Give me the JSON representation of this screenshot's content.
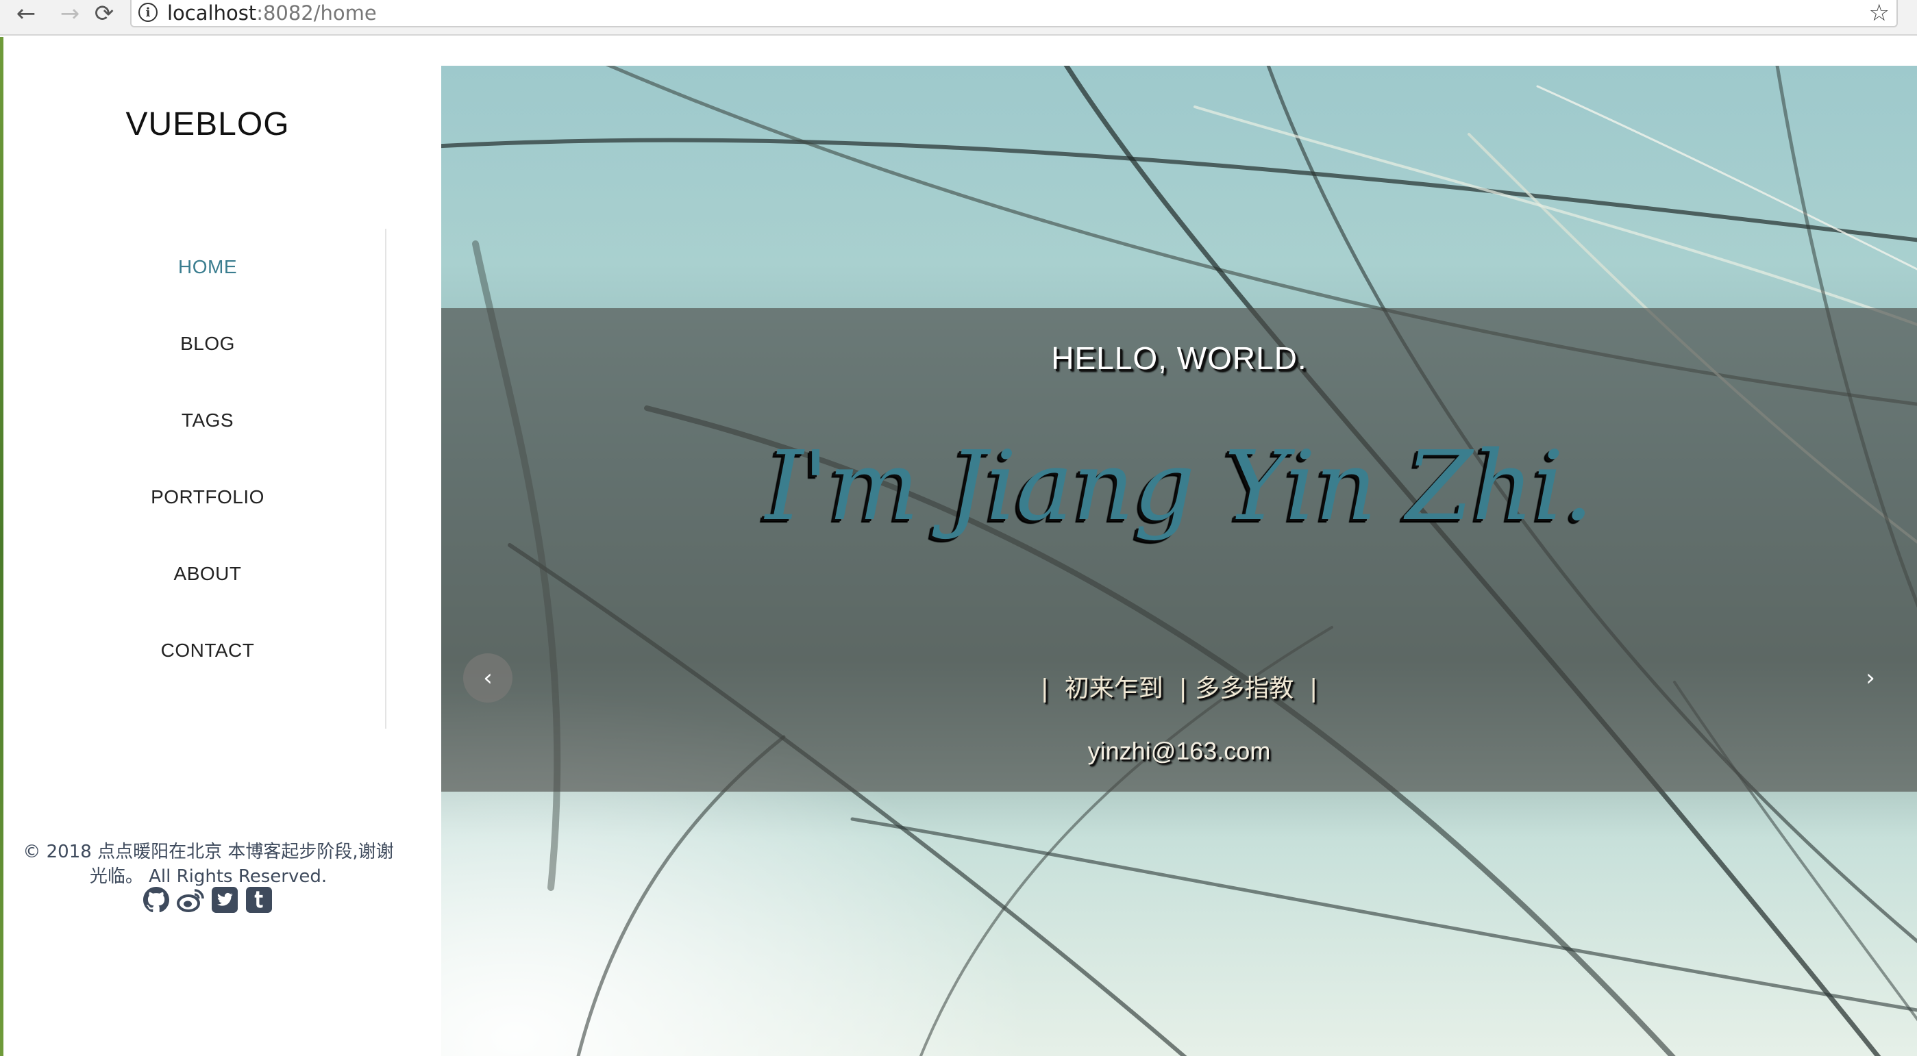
{
  "browser": {
    "back_icon": "arrow-left-icon",
    "forward_icon": "arrow-right-icon",
    "reload_icon": "reload-icon",
    "url_host": "localhost",
    "url_rest": ":8082/home",
    "bookmark_icon": "star-icon"
  },
  "sidebar": {
    "site_title": "VUEBLOG",
    "nav_items": [
      {
        "label": "HOME",
        "active": true
      },
      {
        "label": "BLOG",
        "active": false
      },
      {
        "label": "TAGS",
        "active": false
      },
      {
        "label": "PORTFOLIO",
        "active": false
      },
      {
        "label": "ABOUT",
        "active": false
      },
      {
        "label": "CONTACT",
        "active": false
      }
    ],
    "footer_text": "© 2018 点点暖阳在北京 本博客起步阶段,谢谢光临。 All Rights Reserved.",
    "social_icons": [
      "github-icon",
      "weibo-icon",
      "twitter-icon",
      "tumblr-icon"
    ]
  },
  "hero": {
    "greeting": "HELLO, WORLD.",
    "headline": "I'm Jiang Yin Zhi.",
    "tagline": "|  初来乍到  | 多多指教  |",
    "email": "yinzhi@163.com",
    "prev_label": "‹",
    "next_label": "›"
  },
  "colors": {
    "active_nav": "#3a7d8f",
    "headline": "#3b7e8e",
    "overlay": "rgba(72,72,70,0.62)",
    "footer_text": "#3e4a5c"
  }
}
